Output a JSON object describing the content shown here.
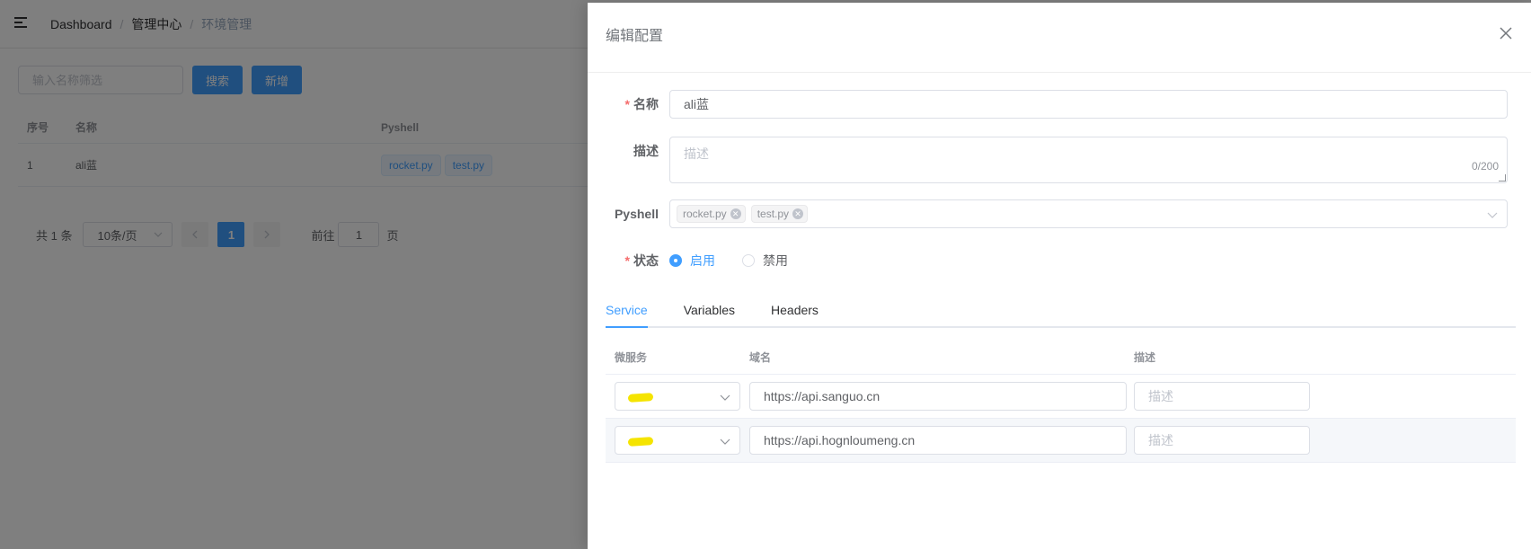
{
  "breadcrumb": [
    "Dashboard",
    "管理中心",
    "环境管理"
  ],
  "filter": {
    "placeholder": "输入名称筛选",
    "search_label": "搜索",
    "add_label": "新增"
  },
  "list_table": {
    "headers": [
      "序号",
      "名称",
      "Pyshell"
    ],
    "rows": [
      {
        "index": "1",
        "name": "ali蓝",
        "pyshell": [
          "rocket.py",
          "test.py"
        ]
      }
    ]
  },
  "pagination": {
    "total": "共 1 条",
    "page_size": "10条/页",
    "current_page": "1",
    "goto_label": "前往",
    "goto_value": "1",
    "page_suffix": "页"
  },
  "drawer": {
    "title": "编辑配置",
    "form": {
      "name_label": "名称",
      "name_value": "ali蓝",
      "desc_label": "描述",
      "desc_placeholder": "描述",
      "desc_counter": "0/200",
      "pyshell_label": "Pyshell",
      "pyshell_selected": [
        "rocket.py",
        "test.py"
      ],
      "status_label": "状态",
      "status_options": [
        "启用",
        "禁用"
      ],
      "status_selected": "启用"
    },
    "tabs": [
      "Service",
      "Variables",
      "Headers"
    ],
    "active_tab": "Service",
    "service_table": {
      "headers": [
        "微服务",
        "域名",
        "描述"
      ],
      "rows": [
        {
          "domain": "https://api.sanguo.cn",
          "desc_placeholder": "描述"
        },
        {
          "domain": "https://api.hognloumeng.cn",
          "desc_placeholder": "描述"
        }
      ]
    }
  },
  "colors": {
    "primary": "#409eff",
    "required": "#f56c6c",
    "redaction": "#f5e400"
  }
}
